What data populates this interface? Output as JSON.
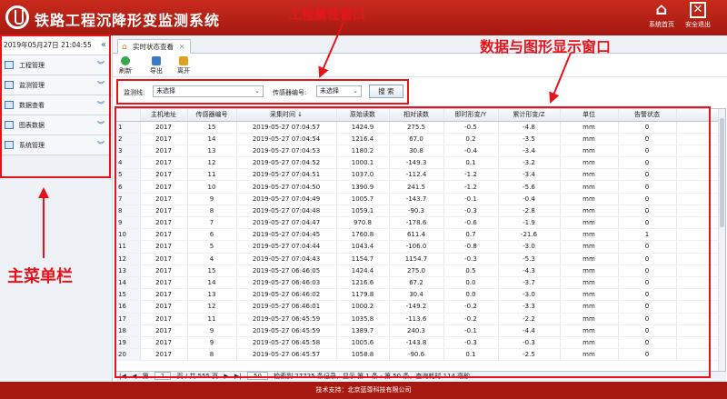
{
  "header": {
    "title": "铁路工程沉降形变监测系统",
    "home_label": "系统首页",
    "exit_label": "安全退出"
  },
  "sidebar": {
    "datetime": "2019年05月27日 21:04:55",
    "collapse_icon": "«",
    "items": [
      {
        "label": "工程管理"
      },
      {
        "label": "监测管理"
      },
      {
        "label": "数据查看"
      },
      {
        "label": "图表数据"
      },
      {
        "label": "系统管理"
      }
    ]
  },
  "tab": {
    "label": "实时状态查看"
  },
  "toolbar": {
    "refresh": "刷新",
    "export": "导出",
    "exit": "离开"
  },
  "filter": {
    "line_label": "监测线:",
    "line_value": "未选择",
    "sensor_label": "传感器编号:",
    "sensor_value": "未选择",
    "search": "搜 索"
  },
  "table": {
    "headers": [
      "",
      "主机地址",
      "传感器编号",
      "采集时间 ↓",
      "原始读数",
      "相对读数",
      "即时形变/Y",
      "累计形变/Z",
      "单位",
      "告警状态"
    ],
    "rows": [
      [
        "1",
        "2017",
        "15",
        "2019-05-27 07:04:57",
        "1424.9",
        "275.5",
        "-0.5",
        "-4.8",
        "mm",
        "0"
      ],
      [
        "2",
        "2017",
        "14",
        "2019-05-27 07:04:54",
        "1216.4",
        "67.0",
        "0.2",
        "-3.5",
        "mm",
        "0"
      ],
      [
        "3",
        "2017",
        "13",
        "2019-05-27 07:04:53",
        "1180.2",
        "30.8",
        "-0.4",
        "-3.4",
        "mm",
        "0"
      ],
      [
        "4",
        "2017",
        "12",
        "2019-05-27 07:04:52",
        "1000.1",
        "-149.3",
        "0.1",
        "-3.2",
        "mm",
        "0"
      ],
      [
        "5",
        "2017",
        "11",
        "2019-05-27 07:04:51",
        "1037.0",
        "-112.4",
        "-1.2",
        "-3.4",
        "mm",
        "0"
      ],
      [
        "6",
        "2017",
        "10",
        "2019-05-27 07:04:50",
        "1390.9",
        "241.5",
        "-1.2",
        "-5.6",
        "mm",
        "0"
      ],
      [
        "7",
        "2017",
        "9",
        "2019-05-27 07:04:49",
        "1005.7",
        "-143.7",
        "-0.1",
        "-0.4",
        "mm",
        "0"
      ],
      [
        "8",
        "2017",
        "8",
        "2019-05-27 07:04:48",
        "1059.1",
        "-90.3",
        "-0.3",
        "-2.8",
        "mm",
        "0"
      ],
      [
        "9",
        "2017",
        "7",
        "2019-05-27 07:04:47",
        "970.8",
        "-178.6",
        "-0.6",
        "-1.9",
        "mm",
        "0"
      ],
      [
        "10",
        "2017",
        "6",
        "2019-05-27 07:04:45",
        "1760.8",
        "611.4",
        "0.7",
        "-21.6",
        "mm",
        "1"
      ],
      [
        "11",
        "2017",
        "5",
        "2019-05-27 07:04:44",
        "1043.4",
        "-106.0",
        "-0.8",
        "-3.0",
        "mm",
        "0"
      ],
      [
        "12",
        "2017",
        "4",
        "2019-05-27 07:04:43",
        "1154.7",
        "1154.7",
        "-0.3",
        "-5.3",
        "mm",
        "0"
      ],
      [
        "13",
        "2017",
        "15",
        "2019-05-27 06:46:05",
        "1424.4",
        "275.0",
        "0.5",
        "-4.3",
        "mm",
        "0"
      ],
      [
        "14",
        "2017",
        "14",
        "2019-05-27 06:46:03",
        "1216.6",
        "67.2",
        "0.0",
        "-3.7",
        "mm",
        "0"
      ],
      [
        "15",
        "2017",
        "13",
        "2019-05-27 06:46:02",
        "1179.8",
        "30.4",
        "0.0",
        "-3.0",
        "mm",
        "0"
      ],
      [
        "16",
        "2017",
        "12",
        "2019-05-27 06:46:01",
        "1000.2",
        "-149.2",
        "-0.2",
        "-3.3",
        "mm",
        "0"
      ],
      [
        "17",
        "2017",
        "11",
        "2019-05-27 06:45:59",
        "1035.8",
        "-113.6",
        "-0.2",
        "-2.2",
        "mm",
        "0"
      ],
      [
        "18",
        "2017",
        "9",
        "2019-05-27 06:45:59",
        "1389.7",
        "240.3",
        "-0.1",
        "-4.4",
        "mm",
        "0"
      ],
      [
        "19",
        "2017",
        "9",
        "2019-05-27 06:45:58",
        "1005.6",
        "-143.8",
        "-0.3",
        "-0.3",
        "mm",
        "0"
      ],
      [
        "20",
        "2017",
        "8",
        "2019-05-27 06:45:57",
        "1058.8",
        "-90.6",
        "0.1",
        "-2.5",
        "mm",
        "0"
      ]
    ]
  },
  "pager": {
    "first": "|◀",
    "prev": "◀",
    "page_prefix": "第",
    "page": "1",
    "page_suffix": "页 / 共 555 页",
    "next": "▶",
    "last": "▶|",
    "size": "50",
    "info": "检索到 27725 条记录，显示 第 1 条 - 第 50 条，查询耗时 114 毫秒"
  },
  "footer": {
    "text": "技术支持：北京蓝尊科技有限公司"
  },
  "annotations": {
    "property_window": "工程属性窗口",
    "display_window": "数据与图形显示窗口",
    "main_menu": "主菜单栏",
    "color": "#e8141b"
  }
}
